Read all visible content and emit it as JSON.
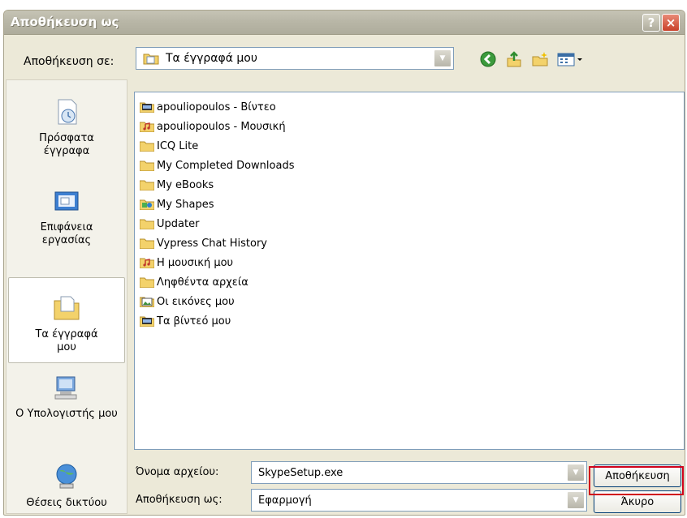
{
  "window": {
    "title": "Αποθήκευση ως"
  },
  "titlebar": {
    "help": "?",
    "close": "×"
  },
  "save_in": {
    "label": "Αποθήκευση σε:",
    "value": "Τα έγγραφά μου"
  },
  "toolbar": {
    "icons": [
      "back-icon",
      "up-folder-icon",
      "new-folder-icon",
      "view-menu-icon"
    ]
  },
  "places": [
    {
      "label": "Πρόσφατα έγγραφα",
      "icon": "recent-documents-icon"
    },
    {
      "label": "Επιφάνεια εργασίας",
      "icon": "desktop-icon"
    },
    {
      "label": "Τα έγγραφά μου",
      "icon": "my-documents-icon",
      "selected": true
    },
    {
      "label": "Ο Υπολογιστής μου",
      "icon": "my-computer-icon"
    },
    {
      "label": "Θέσεις δικτύου",
      "icon": "network-places-icon"
    }
  ],
  "files": [
    {
      "name": "apouliopoulos - Βίντεο",
      "icon": "video-folder-icon"
    },
    {
      "name": "apouliopoulos - Μουσική",
      "icon": "music-folder-icon"
    },
    {
      "name": "ICQ Lite",
      "icon": "folder-icon"
    },
    {
      "name": "My Completed Downloads",
      "icon": "folder-icon"
    },
    {
      "name": "My eBooks",
      "icon": "folder-icon"
    },
    {
      "name": "My Shapes",
      "icon": "shapes-folder-icon"
    },
    {
      "name": "Updater",
      "icon": "folder-icon"
    },
    {
      "name": "Vypress Chat History",
      "icon": "folder-icon"
    },
    {
      "name": "Η μουσική μου",
      "icon": "music-folder-icon"
    },
    {
      "name": "Ληφθέντα αρχεία",
      "icon": "folder-icon"
    },
    {
      "name": "Οι εικόνες μου",
      "icon": "pictures-folder-icon"
    },
    {
      "name": "Τα βίντεό μου",
      "icon": "video-folder-icon"
    }
  ],
  "filename": {
    "label": "Όνομα αρχείου:",
    "value": "SkypeSetup.exe"
  },
  "filetype": {
    "label": "Αποθήκευση ως:",
    "value": "Εφαρμογή"
  },
  "buttons": {
    "save": "Αποθήκευση",
    "cancel": "Άκυρο"
  },
  "colors": {
    "highlight": "#d0021b",
    "folder": "#f3d26b"
  }
}
